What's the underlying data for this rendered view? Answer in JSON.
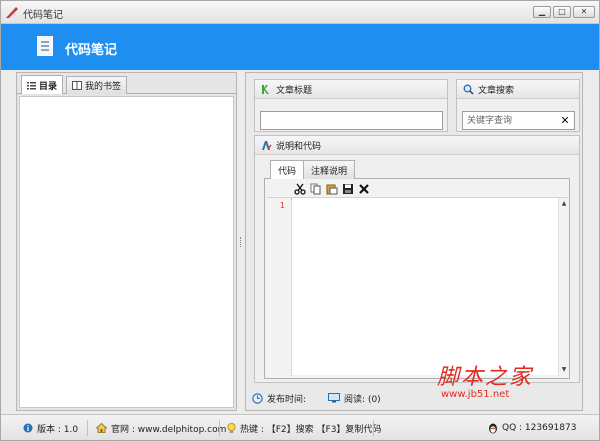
{
  "window": {
    "title": "代码笔记",
    "minimize_label": "▁",
    "maximize_label": "□",
    "close_label": "✕"
  },
  "header": {
    "title": "代码笔记"
  },
  "left_panel": {
    "tabs": [
      {
        "label": "目录",
        "active": true
      },
      {
        "label": "我的书签",
        "active": false
      }
    ]
  },
  "right_panel": {
    "article_title": {
      "label": "文章标题",
      "value": ""
    },
    "article_search": {
      "label": "文章搜索",
      "placeholder": "关键字查询",
      "clear": "✕"
    },
    "desc_code": {
      "label": "说明和代码",
      "tabs": [
        {
          "label": "代码",
          "active": true
        },
        {
          "label": "注释说明",
          "active": false
        }
      ],
      "toolbar": [
        "cut",
        "copy",
        "paste",
        "save",
        "delete"
      ],
      "line_numbers": [
        "1"
      ]
    },
    "meta": {
      "publish_label": "发布时间:",
      "publish_value": "",
      "read_label": "阅读: (0)"
    }
  },
  "statusbar": {
    "version": "版本 : 1.0",
    "website": "官网 : www.delphitop.com",
    "hotkeys": "热键 : 【F2】搜索 【F3】复制代码",
    "qq": "QQ : 123691873"
  },
  "watermark": {
    "text": "脚本之家",
    "url": "www.jb51.net"
  },
  "colors": {
    "header_bg": "#1e8ff0",
    "line_number": "#d13b2b",
    "watermark": "#e12b1f"
  }
}
